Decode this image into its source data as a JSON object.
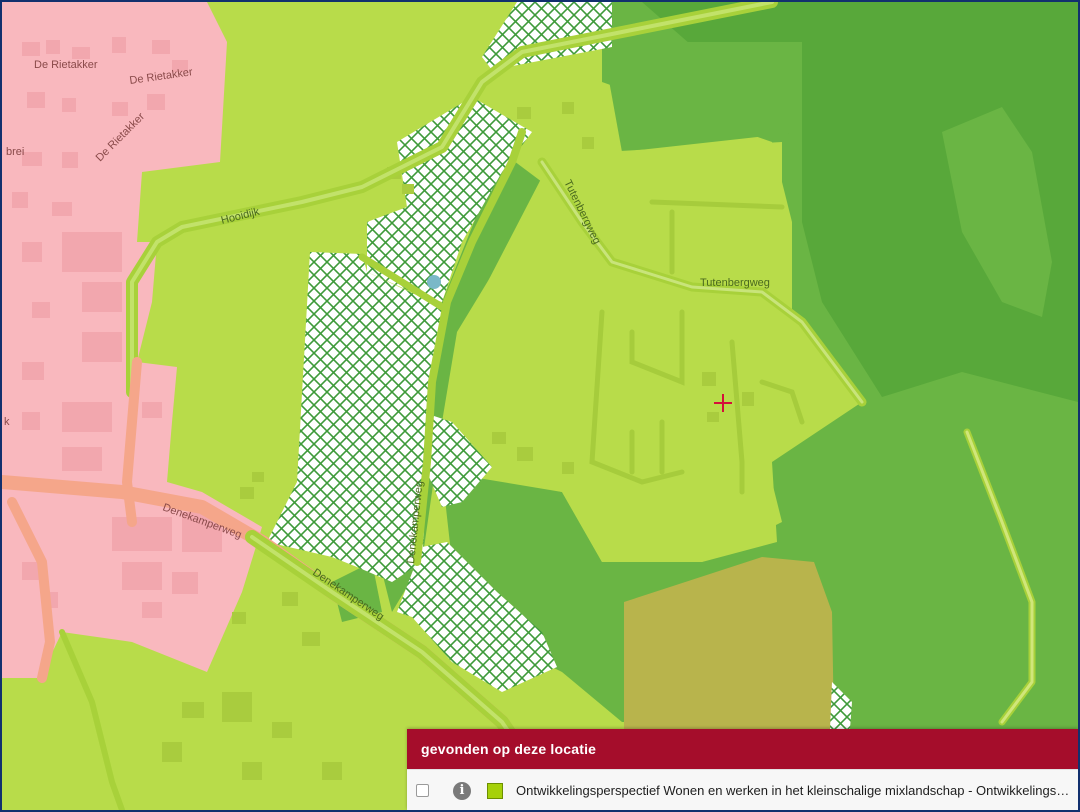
{
  "map": {
    "street_labels": {
      "de_rietakker_1": "De Rietakker",
      "de_rietakker_2": "De Rietakker",
      "de_rietakker_3": "De Rietakker",
      "brei": "brei",
      "hooidijk": "Hooidijk",
      "tutenbergweg_1": "Tutenbergweg",
      "tutenbergweg_2": "Tutenbergweg",
      "denekamperweg_1": "Denekamperweg",
      "denekamperweg_2": "Denekamperweg",
      "denekamperweg_3": "Denekamperweg",
      "k": "k"
    },
    "colors": {
      "light_green": "#b8dc4a",
      "medium_green": "#6ab544",
      "dark_green": "#58a83a",
      "pink_built_area": "#f9b8be",
      "olive": "#b8b44c",
      "hatch": "#3e9a3a",
      "marker": "#d4103a"
    }
  },
  "result_panel": {
    "title": "gevonden op deze locatie",
    "header_color": "#a50d2b",
    "item": {
      "checked": false,
      "info_icon": "info-icon",
      "swatch_color": "#a6d10a",
      "label": "Ontwikkelingsperspectief Wonen en werken in het kleinschalige mixlandschap - Ontwikkelingsp..."
    }
  }
}
